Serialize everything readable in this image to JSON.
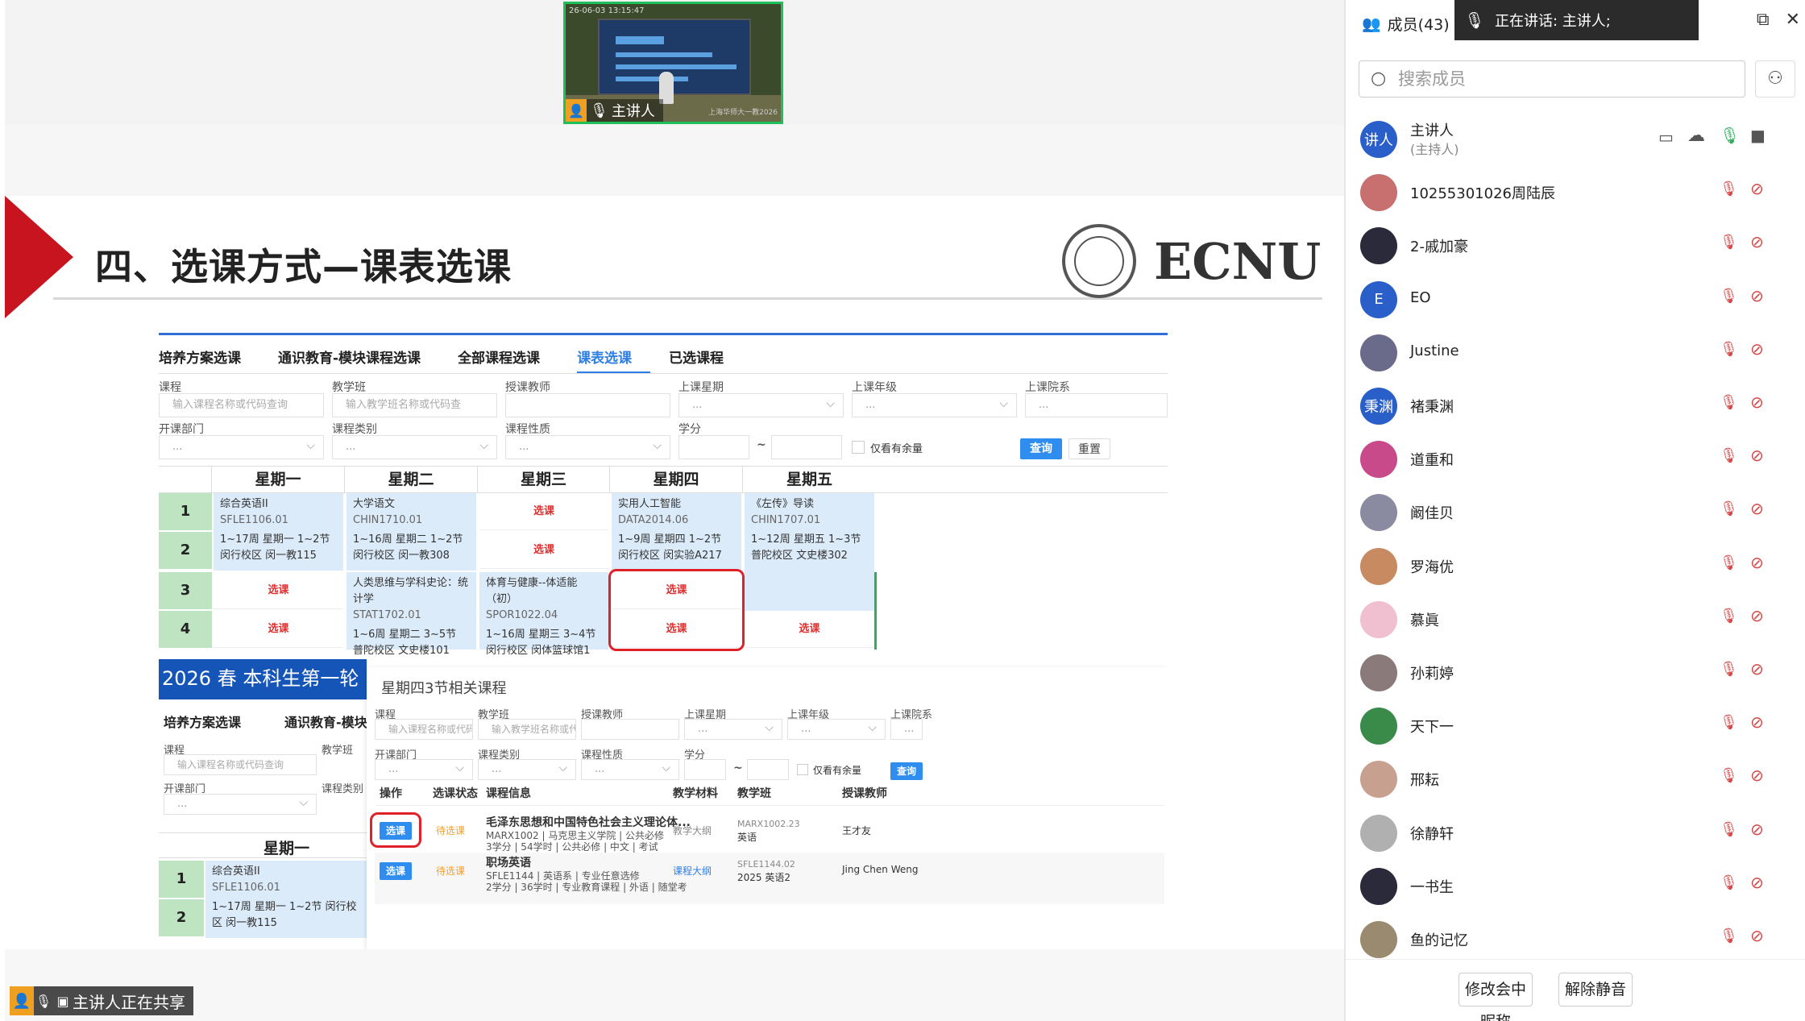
{
  "thumbnail": {
    "timestamp": "26-06-03 13:15:47",
    "speaker_label": "主讲人",
    "watermark": "上海华师大一教2026"
  },
  "slide": {
    "title": "四、选课方式—课表选课",
    "logo_text": "ECNU",
    "tabs": [
      "培养方案选课",
      "通识教育-模块课程选课",
      "全部课程选课",
      "课表选课",
      "已选课程"
    ],
    "filters": {
      "labels": [
        "课程",
        "教学班",
        "授课教师",
        "上课星期",
        "上课年级",
        "上课院系",
        "开课部门",
        "课程类别",
        "课程性质",
        "学分"
      ],
      "course_ph": "输入课程名称或代码查询",
      "class_ph": "输入教学班名称或代码查",
      "dots": "...",
      "tilde": "~",
      "only_remaining": "仅看有余量",
      "query": "查询",
      "reset": "重置"
    },
    "weekdays": [
      "星期一",
      "星期二",
      "星期三",
      "星期四",
      "星期五"
    ],
    "periods": [
      "1",
      "2",
      "3",
      "4"
    ],
    "pick": "选课",
    "cells": {
      "mon12": {
        "name": "综合英语II",
        "code": "SFLE1106.01",
        "info": "1~17周 星期一 1~2节 闵行校区 闵一教115"
      },
      "tue12": {
        "name": "大学语文",
        "code": "CHIN1710.01",
        "info": "1~16周 星期二 1~2节 闵行校区 闵一教308"
      },
      "thu12": {
        "name": "实用人工智能",
        "code": "DATA2014.06",
        "info": "1~9周 星期四 1~2节 闵行校区 闵实验A217"
      },
      "fri12": {
        "name": "《左传》导读",
        "code": "CHIN1707.01",
        "info": "1~12周 星期五 1~3节 普陀校区 文史楼302"
      },
      "tue34": {
        "name": "人类思维与学科史论：统计学",
        "code": "STAT1702.01",
        "info": "1~6周 星期二 3~5节 普陀校区 文史楼101"
      },
      "wed34": {
        "name": "体育与健康--体适能（初）",
        "code": "SPOR1022.04",
        "info": "1~16周 星期三 3~4节 闵行校区 闵体篮球馆1"
      }
    },
    "overlay": {
      "title": "2026 春 本科生第一轮",
      "tabs": [
        "培养方案选课",
        "通识教育-模块"
      ],
      "labels": [
        "课程",
        "教学班",
        "开课部门",
        "课程类别"
      ],
      "course_ph": "输入课程名称或代码查询",
      "weekday": "星期一",
      "mon12_name": "综合英语II",
      "mon12_code": "SFLE1106.01",
      "mon12_info": "1~17周 星期一 1~2节 闵行校区 闵一教115"
    },
    "popup": {
      "title": "星期四3节相关课程",
      "labels": [
        "课程",
        "教学班",
        "授课教师",
        "上课星期",
        "上课年级",
        "上课院系",
        "开课部门",
        "课程类别",
        "课程性质",
        "学分"
      ],
      "course_ph": "输入课程名称或代码",
      "class_ph": "输入教学班名称或代",
      "query": "查询",
      "only_remaining": "仅看有余量",
      "columns": [
        "操作",
        "选课状态",
        "课程信息",
        "教学材料",
        "教学班",
        "授课教师"
      ],
      "rows": [
        {
          "action": "选课",
          "status": "待选课",
          "title": "毛泽东思想和中国特色社会主义理论体...",
          "meta1": "MARX1002 | 马克思主义学院 | 公共必修",
          "meta2": "3学分 | 54学时 | 公共必修 | 中文 | 考试",
          "material": "教学大纲",
          "class_code": "MARX1002.23",
          "class_name": "英语",
          "teacher": "王才友"
        },
        {
          "action": "选课",
          "status": "待选课",
          "title": "职场英语",
          "meta1": "SFLE1144 | 英语系 | 专业任意选修",
          "meta2": "2学分 | 36学时 | 专业教育课程 | 外语 | 随堂考",
          "material": "课程大纲",
          "class_code": "SFLE1144.02",
          "class_name": "2025 英语2",
          "teacher": "Jing Chen Weng"
        }
      ]
    }
  },
  "status_bar": {
    "sharing_text": "主讲人正在共享"
  },
  "panel": {
    "members_label": "成员(43)",
    "speaking": "正在讲话:  主讲人;",
    "search_placeholder": "搜索成员",
    "members": [
      {
        "avatar": "讲人",
        "name": "主讲人",
        "role": "(主持人)",
        "color": "#2a5ec9"
      },
      {
        "avatar": "",
        "name": "10255301026周陆辰",
        "color": "#c87070"
      },
      {
        "avatar": "",
        "name": "2-戚加豪",
        "color": "#2a2a3a"
      },
      {
        "avatar": "E",
        "name": "EO",
        "color": "#2a5ec9"
      },
      {
        "avatar": "",
        "name": "Justine",
        "color": "#6a6a8a"
      },
      {
        "avatar": "秉渊",
        "name": "褚秉渊",
        "color": "#2a5ec9"
      },
      {
        "avatar": "",
        "name": "道重和",
        "color": "#c84a8a"
      },
      {
        "avatar": "",
        "name": "阚佳贝",
        "color": "#8a8aa0"
      },
      {
        "avatar": "",
        "name": "罗海优",
        "color": "#c88a60"
      },
      {
        "avatar": "",
        "name": "慕眞",
        "color": "#f0c0d0"
      },
      {
        "avatar": "",
        "name": "孙莉婷",
        "color": "#8a7a7a"
      },
      {
        "avatar": "",
        "name": "天下一",
        "color": "#3a8a4a"
      },
      {
        "avatar": "",
        "name": "邢耘",
        "color": "#c8a090"
      },
      {
        "avatar": "",
        "name": "徐静轩",
        "color": "#b0b0b0"
      },
      {
        "avatar": "",
        "name": "一书生",
        "color": "#2a2a3a"
      },
      {
        "avatar": "",
        "name": "鱼的记忆",
        "color": "#9a8a70"
      }
    ],
    "edit_nickname": "修改会中昵称",
    "unmute": "解除静音"
  }
}
